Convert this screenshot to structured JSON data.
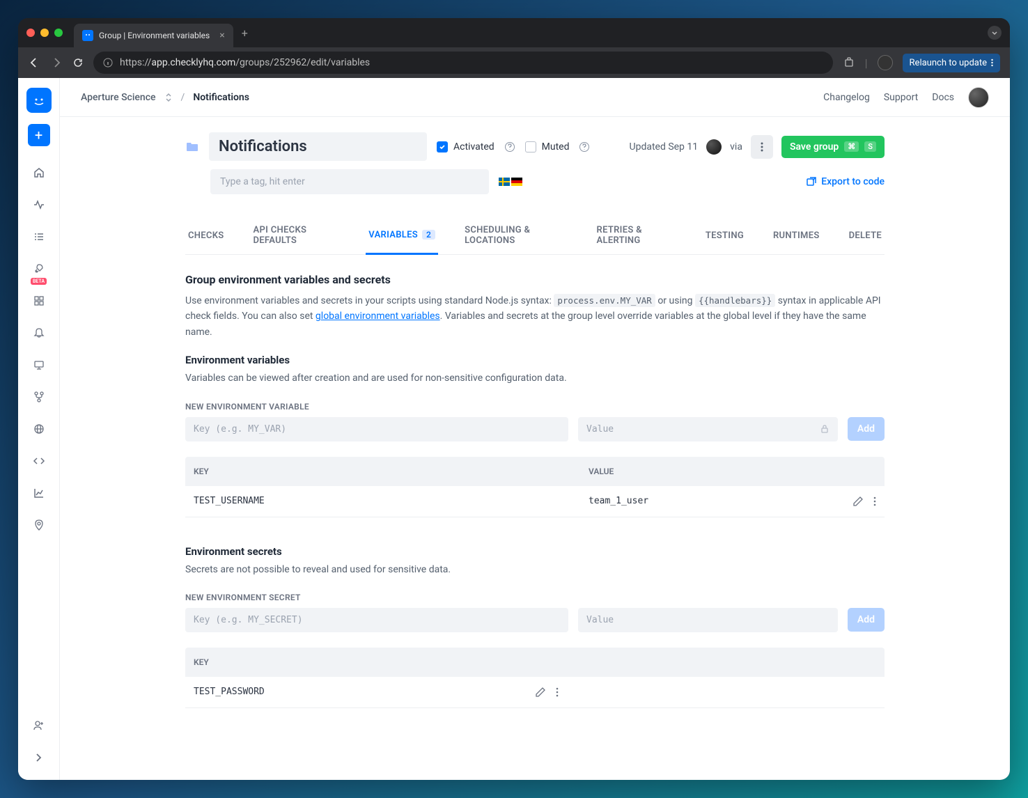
{
  "browser": {
    "tab_title": "Group | Environment variables",
    "url_prefix": "https://",
    "url_domain": "app.checklyhq.com",
    "url_path": "/groups/252962/edit/variables",
    "relaunch": "Relaunch to update"
  },
  "topbar": {
    "org": "Aperture Science",
    "current": "Notifications",
    "links": {
      "changelog": "Changelog",
      "support": "Support",
      "docs": "Docs"
    }
  },
  "header": {
    "group_name": "Notifications",
    "activated": "Activated",
    "muted": "Muted",
    "updated": "Updated Sep 11",
    "via": "via",
    "save": "Save group",
    "tag_placeholder": "Type a tag, hit enter",
    "export": "Export to code"
  },
  "tabs": {
    "checks": "CHECKS",
    "api_defaults": "API CHECKS DEFAULTS",
    "variables": "VARIABLES",
    "variables_count": "2",
    "scheduling": "SCHEDULING & LOCATIONS",
    "retries": "RETRIES & ALERTING",
    "testing": "TESTING",
    "runtimes": "RUNTIMES",
    "delete": "DELETE"
  },
  "section": {
    "title": "Group environment variables and secrets",
    "desc1": "Use environment variables and secrets in your scripts using standard Node.js syntax: ",
    "code1": "process.env.MY_VAR",
    "desc2": " or using ",
    "code2": "{{handlebars}}",
    "desc3": " syntax in applicable API check fields. You can also set ",
    "link": "global environment variables",
    "desc4": ". Variables and secrets at the group level override variables at the global level if they have the same name."
  },
  "env_vars": {
    "title": "Environment variables",
    "desc": "Variables can be viewed after creation and are used for non-sensitive configuration data.",
    "new_label": "NEW ENVIRONMENT VARIABLE",
    "key_placeholder": "Key (e.g. MY_VAR)",
    "value_placeholder": "Value",
    "add": "Add",
    "col_key": "KEY",
    "col_value": "VALUE",
    "rows": [
      {
        "key": "TEST_USERNAME",
        "value": "team_1_user"
      }
    ]
  },
  "secrets": {
    "title": "Environment secrets",
    "desc": "Secrets are not possible to reveal and used for sensitive data.",
    "new_label": "NEW ENVIRONMENT SECRET",
    "key_placeholder": "Key (e.g. MY_SECRET)",
    "value_placeholder": "Value",
    "add": "Add",
    "col_key": "KEY",
    "rows": [
      {
        "key": "TEST_PASSWORD"
      }
    ]
  }
}
